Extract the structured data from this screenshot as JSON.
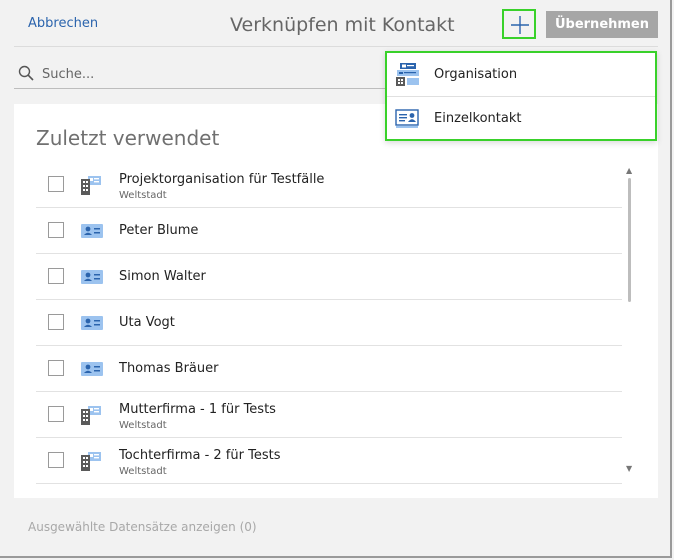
{
  "header": {
    "cancel_label": "Abbrechen",
    "title": "Verknüpfen mit Kontakt",
    "apply_label": "Übernehmen"
  },
  "search": {
    "placeholder": "Suche..."
  },
  "recent": {
    "title": "Zuletzt verwendet",
    "items": [
      {
        "name": "Projektorganisation für Testfälle",
        "sub": "Weltstadt",
        "type": "organisation-icon"
      },
      {
        "name": "Peter Blume",
        "sub": "",
        "type": "contact-card-icon"
      },
      {
        "name": "Simon Walter",
        "sub": "",
        "type": "contact-card-icon"
      },
      {
        "name": "Uta Vogt",
        "sub": "",
        "type": "contact-card-icon"
      },
      {
        "name": "Thomas Bräuer",
        "sub": "",
        "type": "contact-card-icon"
      },
      {
        "name": "Mutterfirma - 1 für Tests",
        "sub": "Weltstadt",
        "type": "organisation-icon"
      },
      {
        "name": "Tochterfirma - 2 für Tests",
        "sub": "Weltstadt",
        "type": "organisation-icon"
      }
    ]
  },
  "add_menu": {
    "items": [
      {
        "label": "Organisation",
        "icon": "organisation-form-icon"
      },
      {
        "label": "Einzelkontakt",
        "icon": "single-contact-icon"
      }
    ]
  },
  "footer": {
    "selected_label": "Ausgewählte Datensätze anzeigen (0)"
  },
  "colors": {
    "accent_link": "#2b64ad",
    "highlight_green": "#39d12a",
    "apply_button": "#a6a6a6",
    "contact_icon_bg": "#9cc3ef"
  }
}
